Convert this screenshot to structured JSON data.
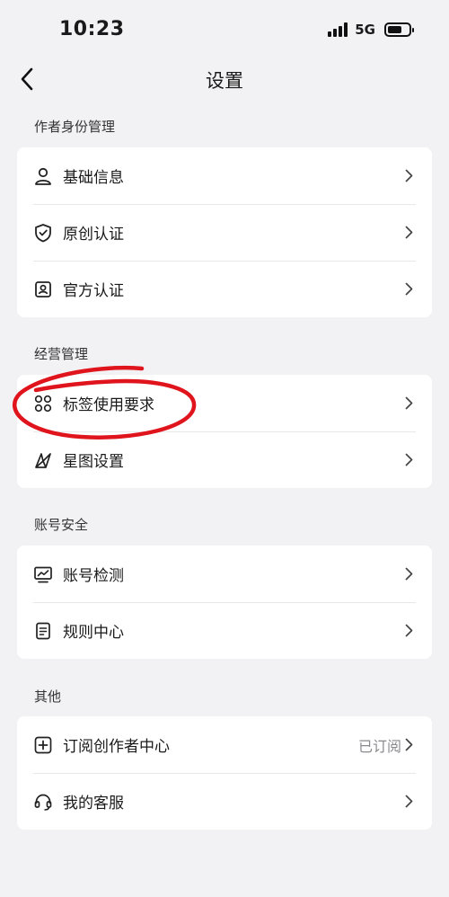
{
  "status_bar": {
    "time": "10:23",
    "network": "5G"
  },
  "nav": {
    "title": "设置",
    "back_icon": "chevron-left-icon"
  },
  "sections": [
    {
      "label": "作者身份管理",
      "items": [
        {
          "label": "基础信息",
          "icon": "user-icon"
        },
        {
          "label": "原创认证",
          "icon": "shield-check-icon"
        },
        {
          "label": "官方认证",
          "icon": "id-badge-icon"
        }
      ]
    },
    {
      "label": "经营管理",
      "items": [
        {
          "label": "标签使用要求",
          "icon": "grid-circles-icon"
        },
        {
          "label": "星图设置",
          "icon": "star-diagram-icon"
        }
      ]
    },
    {
      "label": "账号安全",
      "items": [
        {
          "label": "账号检测",
          "icon": "monitor-chart-icon"
        },
        {
          "label": "规则中心",
          "icon": "document-icon"
        }
      ]
    },
    {
      "label": "其他",
      "items": [
        {
          "label": "订阅创作者中心",
          "icon": "plus-square-icon",
          "value": "已订阅"
        },
        {
          "label": "我的客服",
          "icon": "headset-icon"
        }
      ]
    }
  ],
  "colors": {
    "background": "#f2f2f4",
    "card": "#ffffff",
    "annotation": "#e0141c"
  }
}
